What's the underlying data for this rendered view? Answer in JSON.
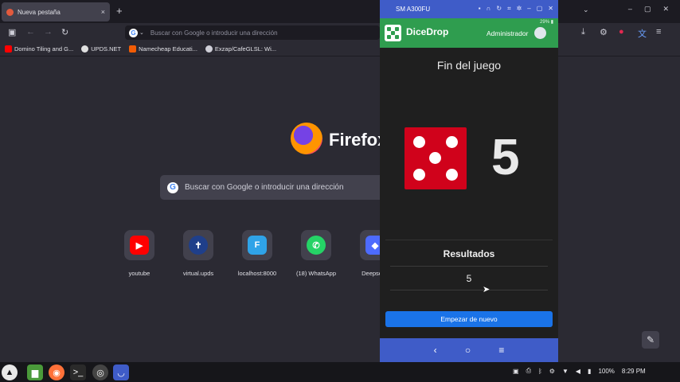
{
  "browser": {
    "tab": {
      "label": "Nueva pestaña",
      "close": "×"
    },
    "new_tab": "+",
    "window_controls": [
      "–",
      "▢",
      "✕"
    ],
    "urlbar_placeholder": "Buscar con Google o introducir una dirección",
    "bookmarks": [
      {
        "label": "Domino Tiling and G...",
        "color": "#ff0000"
      },
      {
        "label": "UPDS.NET",
        "color": "#e0e0e0"
      },
      {
        "label": "Namecheap Educati...",
        "color": "#f25c05"
      },
      {
        "label": "Exzap/CafeGLSL: Wi...",
        "color": "#cfcfd8"
      }
    ],
    "brand": "Firefox",
    "search_placeholder": "Buscar con Google o introducir una dirección",
    "shortcuts": [
      {
        "label": "youtube",
        "icon": "youtube-icon",
        "color": "#ff0000",
        "glyph": "▶"
      },
      {
        "label": "virtual.upds",
        "icon": "upds-icon",
        "color": "#1f3f8a",
        "glyph": "✝"
      },
      {
        "label": "localhost:8000",
        "icon": "flutter-icon",
        "color": "#2fa3e8",
        "glyph": "F"
      },
      {
        "label": "(18) WhatsApp",
        "icon": "whatsapp-icon",
        "color": "#25d366",
        "glyph": "✆"
      },
      {
        "label": "Deepseek",
        "icon": "deepseek-icon",
        "color": "#4d6bfe",
        "glyph": "◆"
      }
    ]
  },
  "phone_window": {
    "title": "SM A300FU",
    "status": "29% ▮",
    "app_name": "DiceDrop",
    "user": "Administrador",
    "game_over": "Fin del juego",
    "die_value": 5,
    "big_number": "5",
    "results_title": "Resultados",
    "results_value": "5",
    "restart_label": "Empezar de nuevo",
    "nav": {
      "back": "‹",
      "home": "○",
      "recents": "≡"
    }
  },
  "taskbar": {
    "battery": "100%",
    "time": "8:29 PM"
  },
  "colors": {
    "app_bar": "#2f9d4f",
    "die": "#d0021b",
    "restart_button": "#1a73e8",
    "phone_chrome": "#3f5cc8"
  }
}
